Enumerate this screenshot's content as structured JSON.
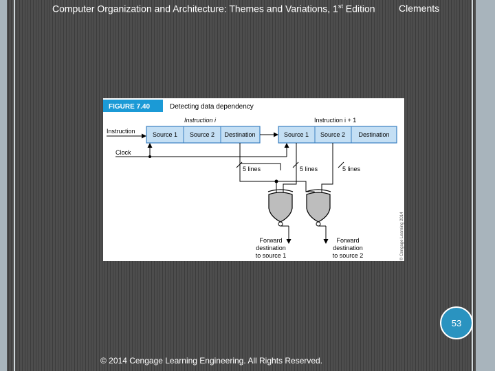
{
  "header": {
    "book_title": "Computer Organization and Architecture: Themes and Variations, 1",
    "superscript": "st",
    "edition": " Edition",
    "author": "Clements"
  },
  "figure": {
    "label": "FIGURE 7.40",
    "caption": "Detecting data dependency",
    "instruction_i": "Instruction i",
    "instruction_i1": "Instruction i + 1",
    "instruction_input": "Instruction",
    "clock": "Clock",
    "fields": [
      "Source 1",
      "Source 2",
      "Destination"
    ],
    "lines": [
      "5 lines",
      "5 lines",
      "5 lines"
    ],
    "outputs": [
      [
        "Forward",
        "destination",
        "to source 1"
      ],
      [
        "Forward",
        "destination",
        "to source 2"
      ]
    ],
    "copyright": "© Cengage Learning 2014",
    "colors": {
      "label_bg": "#1b9ad6",
      "register_fill": "#c4dff4",
      "register_stroke": "#3a7fc0",
      "gate_fill": "#bdbdbd"
    }
  },
  "slide_number": "53",
  "footer": "© 2014 Cengage Learning Engineering. All Rights Reserved."
}
